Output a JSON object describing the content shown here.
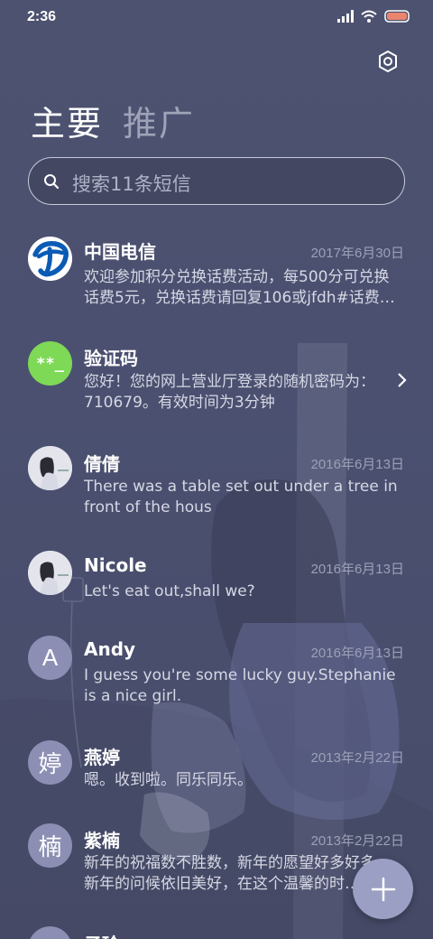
{
  "status_bar": {
    "time": "2:36",
    "icons": [
      "signal-icon",
      "wifi-icon",
      "battery-icon"
    ],
    "battery_color": "#e9846d"
  },
  "header": {
    "settings_icon": "gear-icon",
    "tabs": [
      {
        "label": "主要",
        "active": true
      },
      {
        "label": "推广",
        "active": false
      }
    ]
  },
  "search": {
    "placeholder": "搜索11条短信",
    "icon": "search-icon"
  },
  "messages": [
    {
      "sender": "中国电信",
      "date": "2017年6月30日",
      "preview": "欢迎参加积分兑换话费活动，每500分可兑换话费5元，兑换话费请回复106或jfdh#话费…",
      "avatar": "china-telecom-logo"
    },
    {
      "sender": "验证码",
      "date": "",
      "preview": "您好！您的网上营业厅登录的随机密码为：710679。有效时间为3分钟",
      "avatar_text": "**_",
      "avatar_color": "#7ed957"
    },
    {
      "sender": "倩倩",
      "date": "2016年6月13日",
      "preview": "There was a table set out under a tree in front of the hous",
      "avatar": "photo-avatar"
    },
    {
      "sender": "Nicole",
      "date": "2016年6月13日",
      "preview": "Let's eat out,shall we?",
      "avatar": "photo-avatar"
    },
    {
      "sender": "Andy",
      "date": "2016年6月13日",
      "preview": "I guess you're some lucky guy.Stephanie is a nice girl.",
      "avatar_text": "A"
    },
    {
      "sender": "燕婷",
      "date": "2013年2月22日",
      "preview": "嗯。收到啦。同乐同乐。",
      "avatar_text": "婷"
    },
    {
      "sender": "紫楠",
      "date": "2013年2月22日",
      "preview": "新年的祝福数不胜数，新年的愿望好多好多，新年的问候依旧美好，在这个温馨的时…",
      "avatar_text": "楠"
    },
    {
      "sender": "子玲",
      "date": "",
      "preview": "",
      "avatar_text": ""
    }
  ],
  "fab": {
    "icon": "plus-icon"
  },
  "colors": {
    "background": "#4b5070",
    "letter_avatar": "#8c8fb3",
    "fab": "#9c9fc4"
  }
}
